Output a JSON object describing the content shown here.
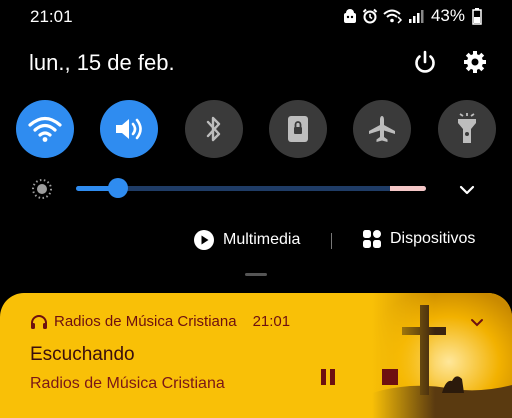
{
  "status_bar": {
    "time": "21:01",
    "battery_percent": "43%",
    "icons": [
      "android-notification-icon",
      "alarm-icon",
      "wifi-calling-icon",
      "signal-icon",
      "battery-icon"
    ]
  },
  "header": {
    "date": "lun., 15 de feb.",
    "icons": [
      "power-icon",
      "gear-icon"
    ]
  },
  "quick_settings": {
    "tiles": [
      {
        "name": "wifi",
        "icon": "wifi-icon",
        "state": "on"
      },
      {
        "name": "sound",
        "icon": "speaker-icon",
        "state": "on"
      },
      {
        "name": "bluetooth",
        "icon": "bluetooth-icon",
        "state": "off"
      },
      {
        "name": "rotation-lock",
        "icon": "rotation-lock-icon",
        "state": "off"
      },
      {
        "name": "airplane-mode",
        "icon": "airplane-icon",
        "state": "off"
      },
      {
        "name": "flashlight",
        "icon": "flashlight-icon",
        "state": "off"
      }
    ],
    "colors": {
      "on": "#2f8cf0",
      "off": "#3a3a3a"
    }
  },
  "brightness": {
    "level": 0.12,
    "icon": "brightness-icon"
  },
  "shortcuts": {
    "media_label": "Multimedia",
    "devices_label": "Dispositivos"
  },
  "media_notification": {
    "app_name": "Radios de Música Cristiana",
    "time": "21:01",
    "title": "Escuchando",
    "subtitle": "Radios de Música Cristiana",
    "state": "playing",
    "colors": {
      "background": "#f9c007",
      "text": "#6e1010"
    }
  }
}
